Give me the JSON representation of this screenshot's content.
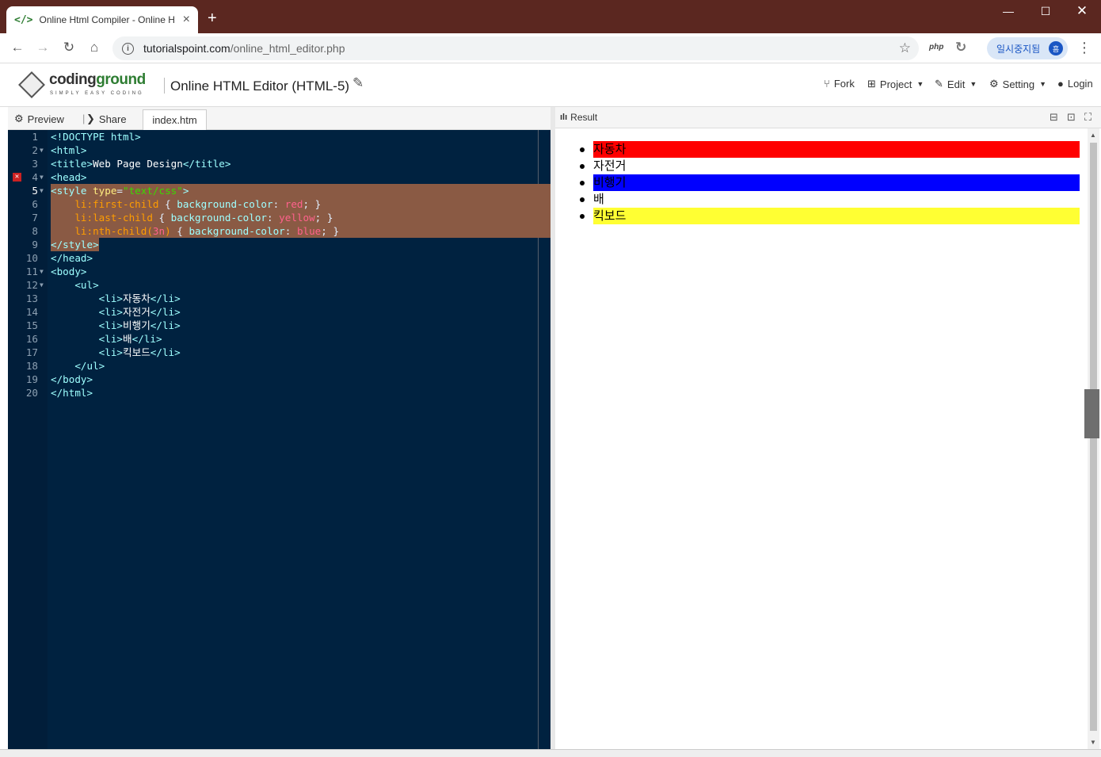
{
  "browser": {
    "tab_title": "Online Html Compiler - Online H",
    "tab_favicon": "</>",
    "url_host": "tutorialspoint.com",
    "url_path": "/online_html_editor.php",
    "ext_php": "php",
    "profile_label": "일시중지됨",
    "profile_initial": "흠"
  },
  "header": {
    "logo_word_a": "coding",
    "logo_word_b": "ground",
    "logo_tagline": "SIMPLY EASY CODING",
    "title": "Online HTML Editor (HTML-5)",
    "menu": {
      "fork": "Fork",
      "project": "Project",
      "edit": "Edit",
      "setting": "Setting",
      "login": "Login"
    }
  },
  "editor_toolbar": {
    "preview": "Preview",
    "share": "Share",
    "file_tab": "index.htm"
  },
  "result_panel": {
    "label": "Result",
    "items": [
      {
        "text": "자동차",
        "bg": "#ff0000"
      },
      {
        "text": "자전거",
        "bg": ""
      },
      {
        "text": "비행기",
        "bg": "#0000ff"
      },
      {
        "text": "배",
        "bg": ""
      },
      {
        "text": "킥보드",
        "bg": "#ffff33"
      }
    ]
  },
  "code_lines": [
    {
      "n": "1",
      "fold": false,
      "err": false,
      "sel": false
    },
    {
      "n": "2",
      "fold": true,
      "err": false,
      "sel": false
    },
    {
      "n": "3",
      "fold": false,
      "err": false,
      "sel": false
    },
    {
      "n": "4",
      "fold": true,
      "err": true,
      "sel": false
    },
    {
      "n": "5",
      "fold": true,
      "err": false,
      "sel": true
    },
    {
      "n": "6",
      "fold": false,
      "err": false,
      "sel": true
    },
    {
      "n": "7",
      "fold": false,
      "err": false,
      "sel": true
    },
    {
      "n": "8",
      "fold": false,
      "err": false,
      "sel": true
    },
    {
      "n": "9",
      "fold": false,
      "err": false,
      "sel": true
    },
    {
      "n": "10",
      "fold": false,
      "err": false,
      "sel": false
    },
    {
      "n": "11",
      "fold": true,
      "err": false,
      "sel": false
    },
    {
      "n": "12",
      "fold": true,
      "err": false,
      "sel": false
    },
    {
      "n": "13",
      "fold": false,
      "err": false,
      "sel": false
    },
    {
      "n": "14",
      "fold": false,
      "err": false,
      "sel": false
    },
    {
      "n": "15",
      "fold": false,
      "err": false,
      "sel": false
    },
    {
      "n": "16",
      "fold": false,
      "err": false,
      "sel": false
    },
    {
      "n": "17",
      "fold": false,
      "err": false,
      "sel": false
    },
    {
      "n": "18",
      "fold": false,
      "err": false,
      "sel": false
    },
    {
      "n": "19",
      "fold": false,
      "err": false,
      "sel": false
    },
    {
      "n": "20",
      "fold": false,
      "err": false,
      "sel": false
    }
  ],
  "code_text": [
    [
      [
        "t",
        "<!DOCTYPE html>"
      ]
    ],
    [
      [
        "t",
        "<html>"
      ]
    ],
    [
      [
        "t",
        "<title>"
      ],
      [
        "v",
        "Web Page Design"
      ],
      [
        "t",
        "</title>"
      ]
    ],
    [
      [
        "t",
        "<head>"
      ]
    ],
    [
      [
        "t",
        "<style "
      ],
      [
        "a",
        "type"
      ],
      [
        "pl",
        "="
      ],
      [
        "s",
        "\"text/css\""
      ],
      [
        "t",
        ">"
      ]
    ],
    [
      [
        "pl",
        "    "
      ],
      [
        "sel1",
        "li:first-child"
      ],
      [
        "pl",
        " { "
      ],
      [
        "prop",
        "background-color"
      ],
      [
        "pl",
        ": "
      ],
      [
        "kw",
        "red"
      ],
      [
        "pl",
        "; }"
      ]
    ],
    [
      [
        "pl",
        "    "
      ],
      [
        "sel1",
        "li:last-child"
      ],
      [
        "pl",
        " { "
      ],
      [
        "prop",
        "background-color"
      ],
      [
        "pl",
        ": "
      ],
      [
        "kw",
        "yellow"
      ],
      [
        "pl",
        "; }"
      ]
    ],
    [
      [
        "pl",
        "    "
      ],
      [
        "sel1",
        "li:nth-child("
      ],
      [
        "kw",
        "3n"
      ],
      [
        "sel1",
        ")"
      ],
      [
        "pl",
        " { "
      ],
      [
        "prop",
        "background-color"
      ],
      [
        "pl",
        ": "
      ],
      [
        "kw",
        "blue"
      ],
      [
        "pl",
        "; }"
      ]
    ],
    [
      [
        "t",
        "</style>"
      ]
    ],
    [
      [
        "t",
        "</head>"
      ]
    ],
    [
      [
        "t",
        "<body>"
      ]
    ],
    [
      [
        "pl",
        "    "
      ],
      [
        "t",
        "<ul>"
      ]
    ],
    [
      [
        "pl",
        "        "
      ],
      [
        "t",
        "<li>"
      ],
      [
        "v",
        "자동차"
      ],
      [
        "t",
        "</li>"
      ]
    ],
    [
      [
        "pl",
        "        "
      ],
      [
        "t",
        "<li>"
      ],
      [
        "v",
        "자전거"
      ],
      [
        "t",
        "</li>"
      ]
    ],
    [
      [
        "pl",
        "        "
      ],
      [
        "t",
        "<li>"
      ],
      [
        "v",
        "비행기"
      ],
      [
        "t",
        "</li>"
      ]
    ],
    [
      [
        "pl",
        "        "
      ],
      [
        "t",
        "<li>"
      ],
      [
        "v",
        "배"
      ],
      [
        "t",
        "</li>"
      ]
    ],
    [
      [
        "pl",
        "        "
      ],
      [
        "t",
        "<li>"
      ],
      [
        "v",
        "킥보드"
      ],
      [
        "t",
        "</li>"
      ]
    ],
    [
      [
        "pl",
        "    "
      ],
      [
        "t",
        "</ul>"
      ]
    ],
    [
      [
        "t",
        "</body>"
      ]
    ],
    [
      [
        "t",
        "</html>"
      ]
    ]
  ]
}
